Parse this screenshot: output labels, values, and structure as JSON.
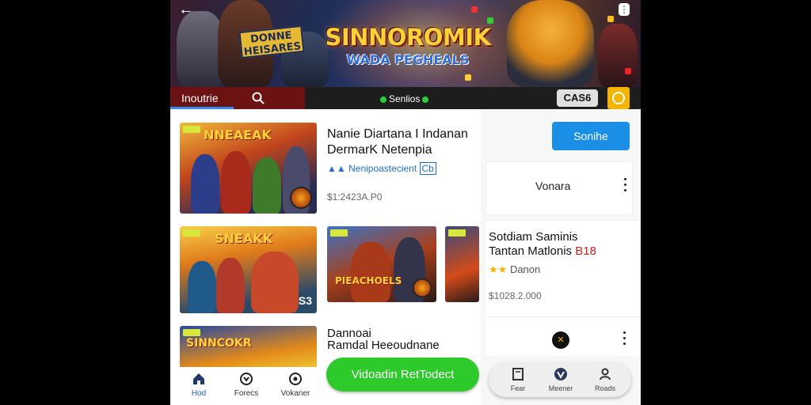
{
  "banner": {
    "sign_text": "DONNE HEISARES",
    "title": "SINNOROMIK",
    "subtitle": "WADA PEGHEALS"
  },
  "tabs": {
    "active_label": "Inoutrie",
    "center_label": "Senlios",
    "price_chip": "CAS6"
  },
  "items": [
    {
      "title_line1": "Nanie Diartana I Indanan",
      "title_line2": "DermarK Netenpia",
      "rating_text": "Nenipoastecient",
      "rating_badge": "Cb",
      "price": "$1:2423A.P0",
      "thumb_title": "NNEAEAK"
    },
    {
      "thumb_title": "SNEAKK",
      "thumb_badge_text": "S3",
      "middle_thumb_title": "PIEACHOELS"
    },
    {
      "title_line1": "Dannoai",
      "title_line2": "Ramdal Heeoudnane",
      "thumb_title": "SINNCOKR"
    }
  ],
  "cta_label": "Vidoadin RetTodect",
  "right": {
    "button_label": "Sonihe",
    "card1_label": "Vonara",
    "card2_title_line1": "Sotdiam Saminis",
    "card2_title_line2": "Tantan Matlonis",
    "card2_title_red": "B18",
    "card2_rating": "Danon",
    "card2_price": "$1028.2.000"
  },
  "bottom_nav_left": [
    {
      "label": "Hod",
      "icon": "home-icon"
    },
    {
      "label": "Forecs",
      "icon": "forecast-icon"
    },
    {
      "label": "Vokaner",
      "icon": "settings-icon"
    }
  ],
  "bottom_nav_right": [
    {
      "label": "Fear",
      "icon": "book-icon"
    },
    {
      "label": "Meener",
      "icon": "vimeo-icon"
    },
    {
      "label": "Roads",
      "icon": "profile-icon"
    }
  ],
  "colors": {
    "tab_active": "#6d1212",
    "accent_blue": "#1b8fe6",
    "cta_green": "#2ec92a",
    "coin": "#f4b400"
  }
}
